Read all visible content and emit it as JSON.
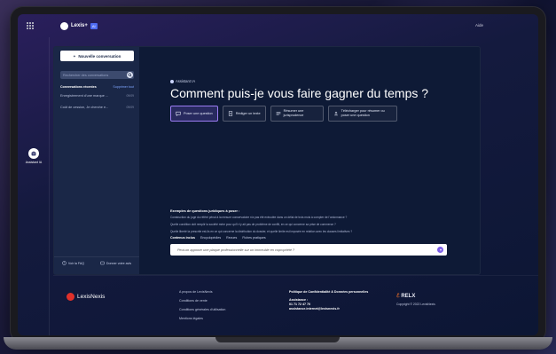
{
  "topbar": {
    "brand": "Lexis+",
    "brand_badge": "AI",
    "help": "Aide"
  },
  "rail": {
    "assistant_label": "Assistant IA"
  },
  "sidebar": {
    "new_conversation": "Nouvelle conversation",
    "search_placeholder": "Rechercher des conversations",
    "recent_title": "Conversations récentes",
    "delete_all": "Supprimer tout",
    "conversations": [
      {
        "title": "Enregistrement d'une marque ...",
        "date": "09/09"
      },
      {
        "title": "Coût de cession, Je cherche e...",
        "date": "09/09"
      }
    ],
    "footer": {
      "faq": "Voir la FAQ",
      "feedback": "Donner votre avis"
    }
  },
  "main": {
    "assistant_label": "Assistant IA",
    "headline": "Comment puis-je vous faire gagner du temps ?",
    "actions": [
      {
        "label": "Poser une question",
        "icon": "chat-icon"
      },
      {
        "label": "Rédiger un texte",
        "icon": "document-icon"
      },
      {
        "label": "Résumer une jurisprudence",
        "icon": "summary-icon"
      },
      {
        "label": "Télécharger pour résumer ou poser une question",
        "icon": "upload-icon"
      }
    ],
    "examples_title": "Exemples de questions juridiques à poser :",
    "examples": [
      "Construction du juge du référé pénal à la mesure conservatoire n'a pas été exécutée dans un délai de trois mois à compter de l'ordonnance ?",
      "Quelle condition doit remplir la société mère pour qu'il n'y ait pas de problème de conflit, en ce qui concerne sa prise de commerce ?",
      "Quelle liberté la prescrite est-ils en ce qui concerne la distribution du dossier, et quelle limite est imposée en relation avec les clauses limitatives ?"
    ],
    "chips": [
      "Contenus inclus",
      "Encyclopédies",
      "Revues",
      "Fiches pratiques"
    ],
    "prompt_placeholder": "Peut-on apposer une plaque professionnelle sur un immeuble en copropriété ?"
  },
  "footer": {
    "brand": "LexisNexis",
    "links": [
      "A propos de LexisNexis",
      "Conditions de vente",
      "Conditions générales d'utilisation",
      "Mentions légales"
    ],
    "privacy": "Politique de Confidentialité & Données personnelles",
    "assistance_label": "Assistance :",
    "phone": "01 71 72 47 70",
    "email": "assistance.internet@lexisnexis.fr",
    "relx": "RELX",
    "copyright": "Copyright © 2022 LexisNexis"
  },
  "colors": {
    "accent": "#7b5ce8",
    "brand_red": "#e0302a",
    "panel": "#0e1a36"
  }
}
